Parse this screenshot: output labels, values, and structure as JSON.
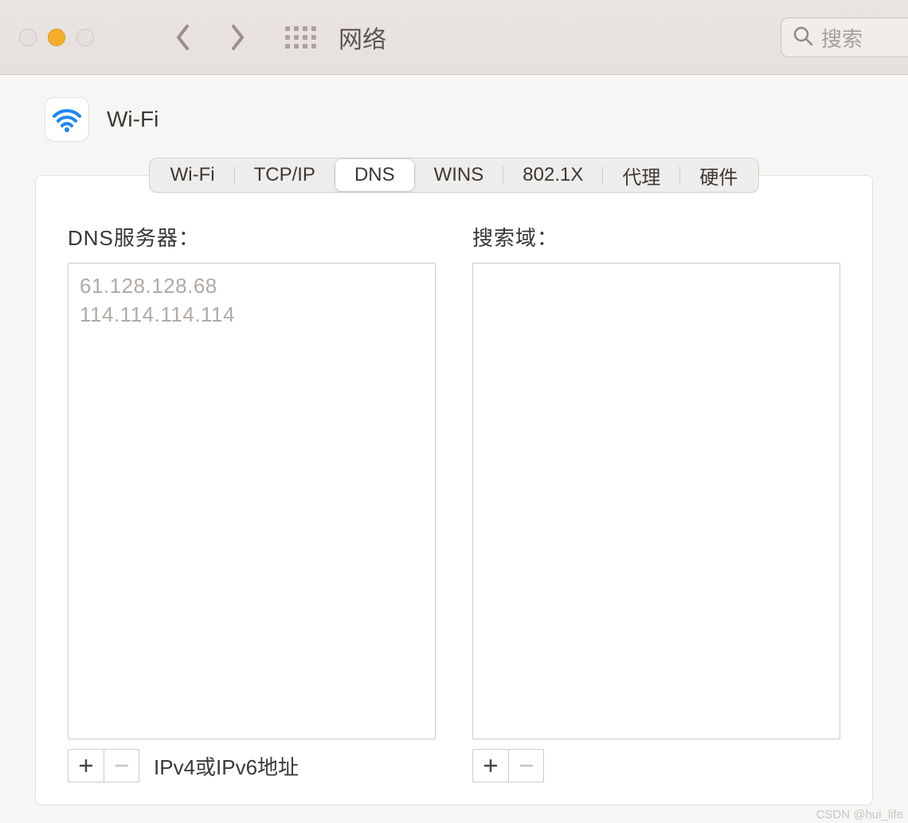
{
  "window": {
    "title": "网络"
  },
  "search": {
    "placeholder": "搜索"
  },
  "interface": {
    "label": "Wi-Fi"
  },
  "tabs": [
    {
      "label": "Wi-Fi",
      "active": false
    },
    {
      "label": "TCP/IP",
      "active": false
    },
    {
      "label": "DNS",
      "active": true
    },
    {
      "label": "WINS",
      "active": false
    },
    {
      "label": "802.1X",
      "active": false
    },
    {
      "label": "代理",
      "active": false
    },
    {
      "label": "硬件",
      "active": false
    }
  ],
  "dns": {
    "label": "DNS服务器：",
    "servers": [
      "61.128.128.68",
      "114.114.114.114"
    ],
    "hint": "IPv4或IPv6地址"
  },
  "search_domains": {
    "label": "搜索域：",
    "domains": []
  },
  "watermark": "CSDN @hui_life"
}
